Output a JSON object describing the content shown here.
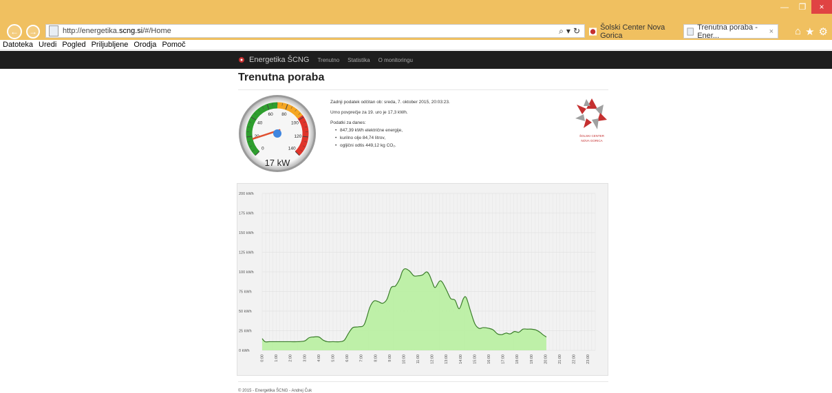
{
  "browser": {
    "url_prefix": "http://energetika.",
    "url_domain": "scng.si",
    "url_suffix": "/#/Home",
    "tabs": [
      {
        "label": "Šolski Center Nova Gorica"
      },
      {
        "label": "Trenutna poraba - Ener...",
        "close": "×"
      }
    ],
    "window_controls": {
      "minimize": "—",
      "restore": "❐",
      "close": "×"
    }
  },
  "menubar": [
    "Datoteka",
    "Uredi",
    "Pogled",
    "Priljubljene",
    "Orodja",
    "Pomoč"
  ],
  "sitenav": {
    "brand": "Energetika ŠCNG",
    "links": [
      "Trenutno",
      "Statistika",
      "O monitoringu"
    ]
  },
  "page": {
    "title": "Trenutna poraba"
  },
  "gauge": {
    "value": 17,
    "label": "17 kW",
    "min": 0,
    "max": 140,
    "ticks": [
      "0",
      "20",
      "40",
      "60",
      "80",
      "100",
      "120",
      "140"
    ],
    "colors": {
      "green": "#2e9e2e",
      "yellow": "#f5a623",
      "red": "#e0342a",
      "needle": "#e05030",
      "hub": "#3f86e0"
    }
  },
  "info": {
    "line1": "Zadnji podatek odčitan ob: sreda, 7. oktober 2015, 20:03:23.",
    "line2": "Urno povprečje za 19. uro je 17,3 kWh.",
    "line3": "Podatki za danes:",
    "items": [
      "847,39 kWh električne energije,",
      "kurilno olje 84,74 litrov,",
      "ogljični odtis 449,12 kg CO₂."
    ]
  },
  "logo": {
    "line1": "ŠOLSKI CENTER",
    "line2": "NOVA GORICA",
    "color": "#c53030"
  },
  "chart_data": {
    "type": "area",
    "ylim": [
      0,
      200
    ],
    "yticks": [
      "0 kWh",
      "25 kWh",
      "50 kWh",
      "75 kWh",
      "100 kWh",
      "125 kWh",
      "150 kWh",
      "175 kWh",
      "200 kWh"
    ],
    "xticks": [
      "0:00",
      "1:00",
      "2:00",
      "3:00",
      "4:00",
      "5:00",
      "6:00",
      "7:00",
      "8:00",
      "9:00",
      "10:00",
      "11:00",
      "12:00",
      "13:00",
      "14:00",
      "15:00",
      "16:00",
      "17:00",
      "18:00",
      "19:00",
      "20:00",
      "21:00",
      "22:00",
      "23:00"
    ],
    "xlim": [
      0,
      23.5
    ],
    "fill_color": "#b8f0a0",
    "line_color": "#3a7d2a",
    "points": [
      [
        0,
        15
      ],
      [
        0.2,
        11
      ],
      [
        0.5,
        11
      ],
      [
        1,
        11
      ],
      [
        1.5,
        11
      ],
      [
        2,
        11
      ],
      [
        2.5,
        11
      ],
      [
        3,
        12
      ],
      [
        3.3,
        16
      ],
      [
        3.6,
        17
      ],
      [
        4,
        17
      ],
      [
        4.3,
        13
      ],
      [
        4.6,
        11
      ],
      [
        5,
        11
      ],
      [
        5.5,
        11
      ],
      [
        5.8,
        13
      ],
      [
        6.1,
        22
      ],
      [
        6.4,
        29
      ],
      [
        6.8,
        30
      ],
      [
        7.2,
        33
      ],
      [
        7.6,
        55
      ],
      [
        7.9,
        63
      ],
      [
        8.2,
        62
      ],
      [
        8.5,
        60
      ],
      [
        8.8,
        65
      ],
      [
        9.1,
        80
      ],
      [
        9.4,
        82
      ],
      [
        9.7,
        91
      ],
      [
        9.9,
        101
      ],
      [
        10.1,
        104
      ],
      [
        10.4,
        101
      ],
      [
        10.7,
        95
      ],
      [
        11,
        95
      ],
      [
        11.3,
        96
      ],
      [
        11.6,
        100
      ],
      [
        11.8,
        96
      ],
      [
        12,
        87
      ],
      [
        12.2,
        80
      ],
      [
        12.5,
        88
      ],
      [
        12.7,
        87
      ],
      [
        13,
        77
      ],
      [
        13.3,
        66
      ],
      [
        13.6,
        64
      ],
      [
        13.9,
        53
      ],
      [
        14.2,
        66
      ],
      [
        14.4,
        67
      ],
      [
        14.7,
        50
      ],
      [
        15,
        34
      ],
      [
        15.3,
        28
      ],
      [
        15.6,
        29
      ],
      [
        16,
        28
      ],
      [
        16.3,
        26
      ],
      [
        16.6,
        21
      ],
      [
        16.9,
        20
      ],
      [
        17.2,
        22
      ],
      [
        17.5,
        21
      ],
      [
        17.8,
        24
      ],
      [
        18.1,
        23
      ],
      [
        18.4,
        27
      ],
      [
        18.7,
        27
      ],
      [
        19,
        27
      ],
      [
        19.3,
        26
      ],
      [
        19.6,
        23
      ],
      [
        19.8,
        20
      ],
      [
        20.05,
        17
      ]
    ]
  },
  "footer": {
    "text": "© 2015 - Energetika ŠCNG - Andrej Čuk"
  }
}
